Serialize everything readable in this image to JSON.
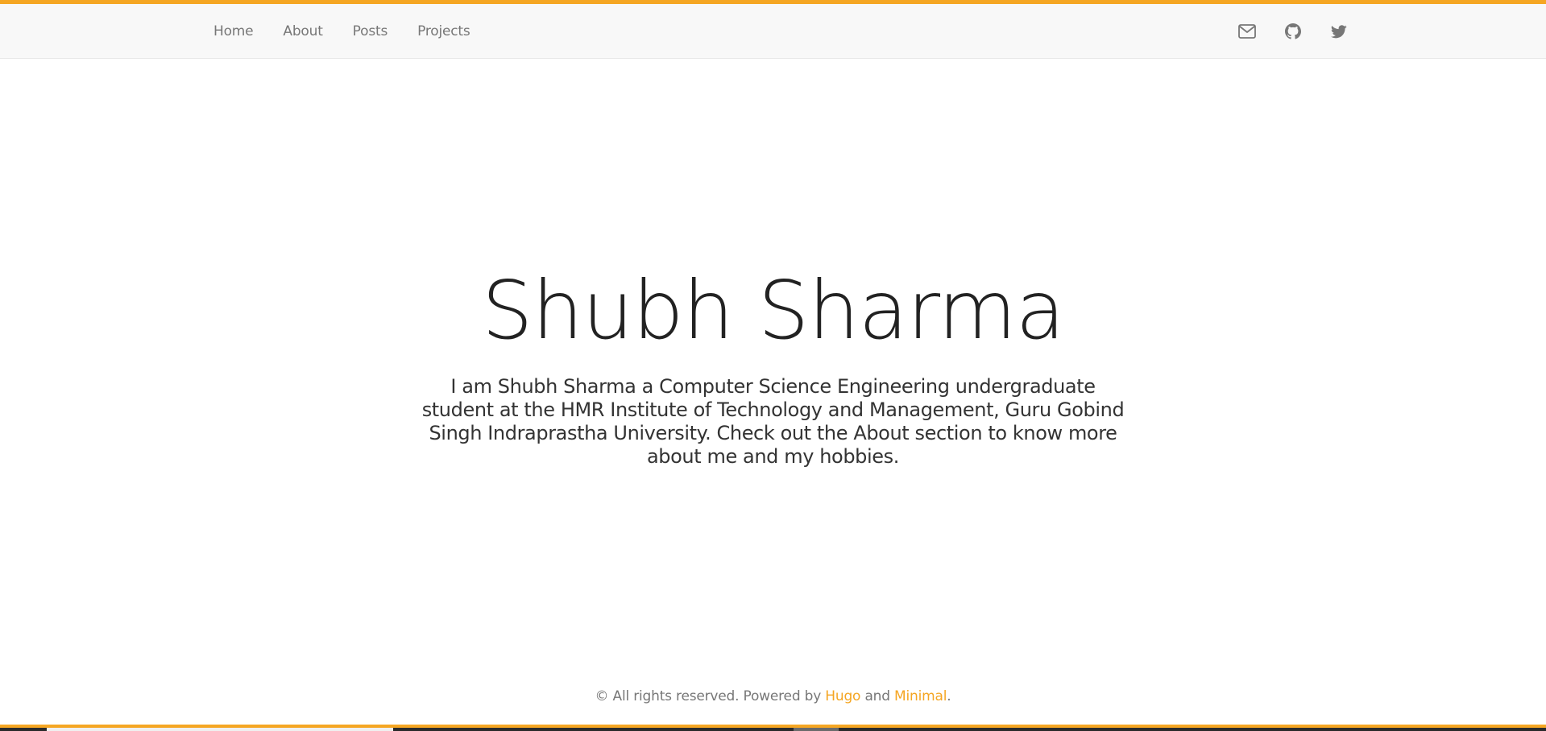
{
  "nav": {
    "links": [
      {
        "label": "Home"
      },
      {
        "label": "About"
      },
      {
        "label": "Posts"
      },
      {
        "label": "Projects"
      }
    ],
    "icons": [
      "mail-icon",
      "github-icon",
      "twitter-icon"
    ]
  },
  "hero": {
    "title": "Shubh Sharma",
    "description": "I am Shubh Sharma a Computer Science Engineering undergraduate student at the HMR Institute of Technology and Management, Guru Gobind Singh Indraprastha University. Check out the About section to know more about me and my hobbies."
  },
  "footer": {
    "prefix": "© All rights reserved. Powered by ",
    "link1": "Hugo",
    "middle": " and ",
    "link2": "Minimal",
    "suffix": "."
  },
  "colors": {
    "accent": "#f5a623",
    "navbar_bg": "#f8f8f8",
    "nav_text": "#777777",
    "title_text": "#222222"
  }
}
